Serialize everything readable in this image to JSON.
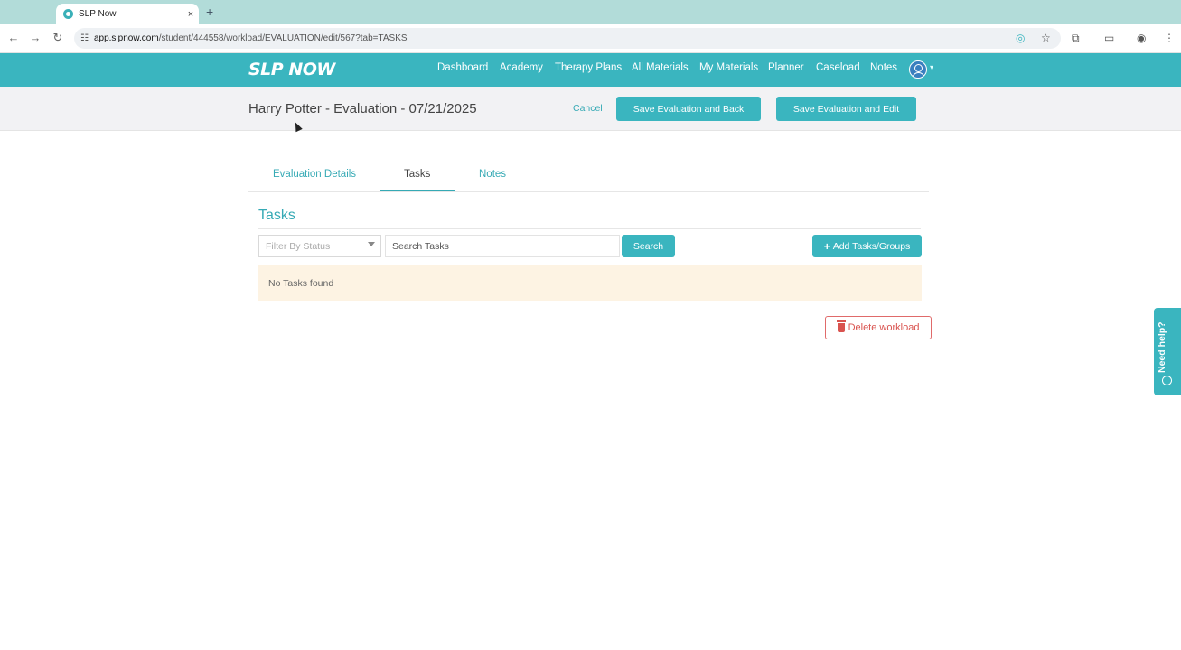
{
  "browser": {
    "tab_title": "SLP Now",
    "tab_close": "×",
    "new_tab": "+",
    "url_host": "app.slpnow.com",
    "url_path": "/student/444558/workload/EVALUATION/edit/567?tab=TASKS",
    "icons": [
      "back-arrow-icon",
      "forward-arrow-icon",
      "reload-icon",
      "site-settings-icon",
      "extension-icon",
      "bookmark-star-icon",
      "extensions-puzzle-icon",
      "side-panel-icon",
      "profile-icon",
      "menu-dots-icon"
    ]
  },
  "app": {
    "logo": "SLP NOW",
    "brand_color": "#3ab5bf",
    "nav": [
      "Dashboard",
      "Academy",
      "Therapy Plans",
      "All Materials",
      "My Materials",
      "Planner",
      "Caseload",
      "Notes"
    ]
  },
  "page": {
    "title": "Harry Potter - Evaluation - 07/21/2025",
    "cancel": "Cancel",
    "save_back": "Save Evaluation and Back",
    "save_edit": "Save Evaluation and Edit"
  },
  "tabs": {
    "details": "Evaluation Details",
    "tasks": "Tasks",
    "notes": "Notes",
    "active": "Tasks"
  },
  "tasks": {
    "heading": "Tasks",
    "filter_placeholder": "Filter By Status",
    "search_placeholder": "Search Tasks",
    "search_button": "Search",
    "add_button": "Add Tasks/Groups",
    "empty_message": "No Tasks found",
    "delete_button": "Delete workload"
  },
  "help": {
    "label": "Need help?"
  }
}
